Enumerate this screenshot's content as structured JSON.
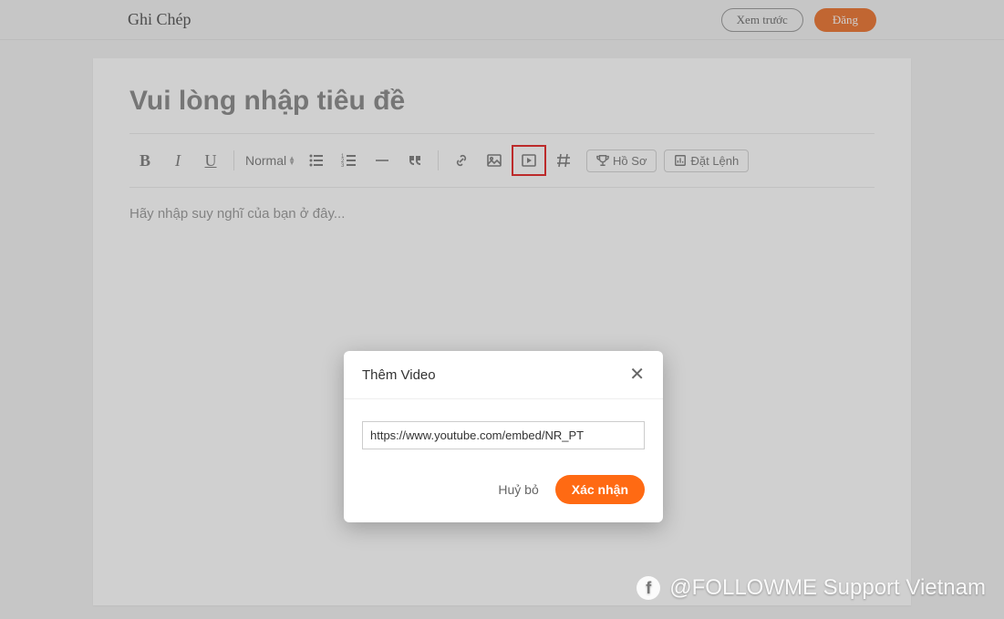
{
  "header": {
    "brand": "Ghi Chép",
    "preview": "Xem trước",
    "publish": "Đăng"
  },
  "editor": {
    "title_placeholder": "Vui lòng nhập tiêu đề",
    "body_placeholder": "Hãy nhập suy nghĩ của bạn ở đây...",
    "format_label": "Normal",
    "profile_btn": "Hồ Sơ",
    "order_btn": "Đặt Lệnh"
  },
  "modal": {
    "title": "Thêm Video",
    "url_value": "https://www.youtube.com/embed/NR_PT",
    "cancel": "Huỷ bỏ",
    "confirm": "Xác nhận"
  },
  "watermark": {
    "text": "@FOLLOWME Support Vietnam"
  }
}
